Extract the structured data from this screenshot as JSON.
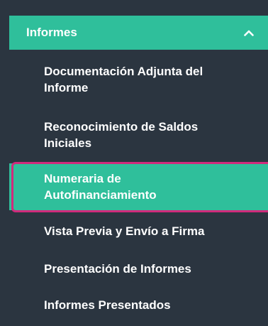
{
  "group": {
    "label": "Informes",
    "expanded": true,
    "chevron_icon": "chevron-up-icon"
  },
  "items": [
    {
      "label": "Documentación Adjunta del Informe",
      "active": false
    },
    {
      "label": "Reconocimiento de Saldos Iniciales",
      "active": false
    },
    {
      "label": "Numeraria de Autofinanciamiento",
      "active": true
    },
    {
      "label": "Vista Previa y Envío a Firma",
      "active": false
    },
    {
      "label": "Presentación de Informes",
      "active": false
    },
    {
      "label": "Informes Presentados",
      "active": false
    }
  ],
  "colors": {
    "sidebar_bg": "#2b3540",
    "accent": "#2fbf9b",
    "highlight_border": "#d12b7c",
    "text": "#ffffff"
  }
}
